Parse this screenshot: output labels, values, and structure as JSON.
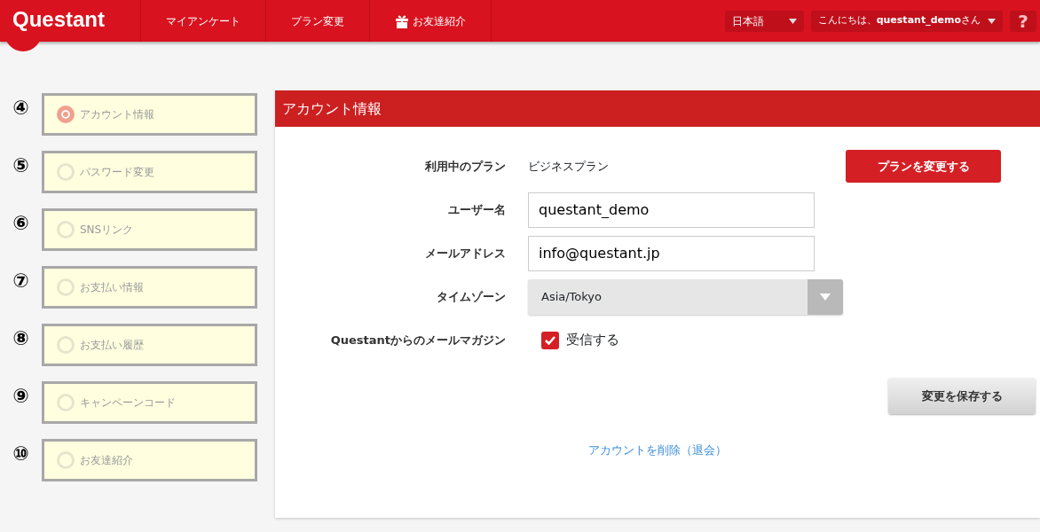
{
  "header": {
    "logo": "Questant",
    "nav": [
      {
        "label": "マイアンケート",
        "kind": "plain"
      },
      {
        "label": "プラン変更",
        "kind": "plain"
      },
      {
        "label": "お友達紹介",
        "kind": "gift"
      }
    ],
    "language": "日本語",
    "greeting": "こんにちは、**questant_demo**さん",
    "help": "?"
  },
  "steps": [
    {
      "marker": "④",
      "label": "アカウント情報",
      "selected": true
    },
    {
      "marker": "⑤",
      "label": "パスワード変更",
      "selected": false
    },
    {
      "marker": "⑥",
      "label": "SNSリンク",
      "selected": false
    },
    {
      "marker": "⑦",
      "label": "お支払い情報",
      "selected": false
    },
    {
      "marker": "⑧",
      "label": "お支払い履歴",
      "selected": false
    },
    {
      "marker": "⑨",
      "label": "キャンペーンコード",
      "selected": false
    },
    {
      "marker": "⑩",
      "label": "お友達紹介",
      "selected": false
    }
  ],
  "panel": {
    "title": "アカウント情報",
    "fields": [
      {
        "kind": "text",
        "label": "利用中のプラン",
        "value": "ビジネスプラン",
        "button": "プランを変更する"
      },
      {
        "kind": "input",
        "label": "ユーザー名",
        "value": "questant_demo"
      },
      {
        "kind": "input",
        "label": "メールアドレス",
        "value": "info@questant.jp"
      },
      {
        "kind": "select",
        "label": "タイムゾーン",
        "value": "Asia/Tokyo"
      },
      {
        "kind": "checkbox",
        "label": "Questantからのメールマガジン",
        "value": "受信する",
        "checked": true
      }
    ],
    "save": "変更を保存する",
    "delete_link": "アカウントを削除（退会）"
  }
}
